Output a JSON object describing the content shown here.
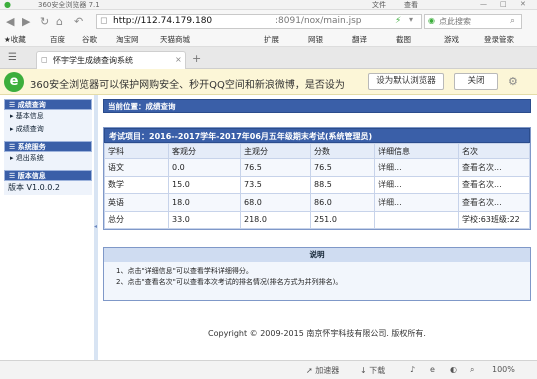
{
  "browser": {
    "window_title": "360安全浏览器 7.1",
    "menu": [
      "文件",
      "查看"
    ],
    "url_host": "http://112.74.179.180",
    "url_path": ":8091/nox/main.jsp",
    "search_placeholder": "点此搜索",
    "bookmarks": [
      "收藏",
      "百度",
      "谷歌",
      "淘宝网",
      "天猫商城",
      "扩展",
      "网银",
      "翻译",
      "截图",
      "游戏",
      "登录管家"
    ],
    "tab_title": "怀宇学生成绩查询系统",
    "notification": {
      "message": "360安全浏览器可以保护网购安全、秒开QQ空间和新浪微博，是否设为",
      "set_default_label": "设为默认浏览器",
      "close_label": "关闭"
    },
    "status": {
      "accelerator": "加速器",
      "download": "下载",
      "zoom": "100%"
    }
  },
  "sidebar": {
    "sections": [
      {
        "title": "成绩查询",
        "items": [
          "基本信息",
          "成绩查询"
        ]
      },
      {
        "title": "系统服务",
        "items": [
          "退出系统"
        ]
      },
      {
        "title": "版本信息",
        "items": []
      }
    ],
    "version": "版本 V1.0.0.2"
  },
  "main": {
    "location": "当前位置：成绩查询",
    "exam_title": "考试项目：2016--2017学年-2017年06月五年级期末考试(系统管理员)",
    "columns": [
      "学科",
      "客观分",
      "主观分",
      "分数",
      "详细信息",
      "名次"
    ],
    "rows": [
      [
        "语文",
        "0.0",
        "76.5",
        "76.5",
        "详细...",
        "查看名次..."
      ],
      [
        "数学",
        "15.0",
        "73.5",
        "88.5",
        "详细...",
        "查看名次..."
      ],
      [
        "英语",
        "18.0",
        "68.0",
        "86.0",
        "详细...",
        "查看名次..."
      ],
      [
        "总分",
        "33.0",
        "218.0",
        "251.0",
        "",
        "学校:63班级:22"
      ]
    ],
    "note_title": "说明",
    "notes": [
      "1、点击\"详细信息\"可以查看学科详细得分。",
      "2、点击\"查看名次\"可以查看本次考试的排名情况(排名方式为并列排名)。"
    ],
    "copyright": "Copyright © 2009-2015 南京怀宇科技有限公司. 版权所有."
  }
}
